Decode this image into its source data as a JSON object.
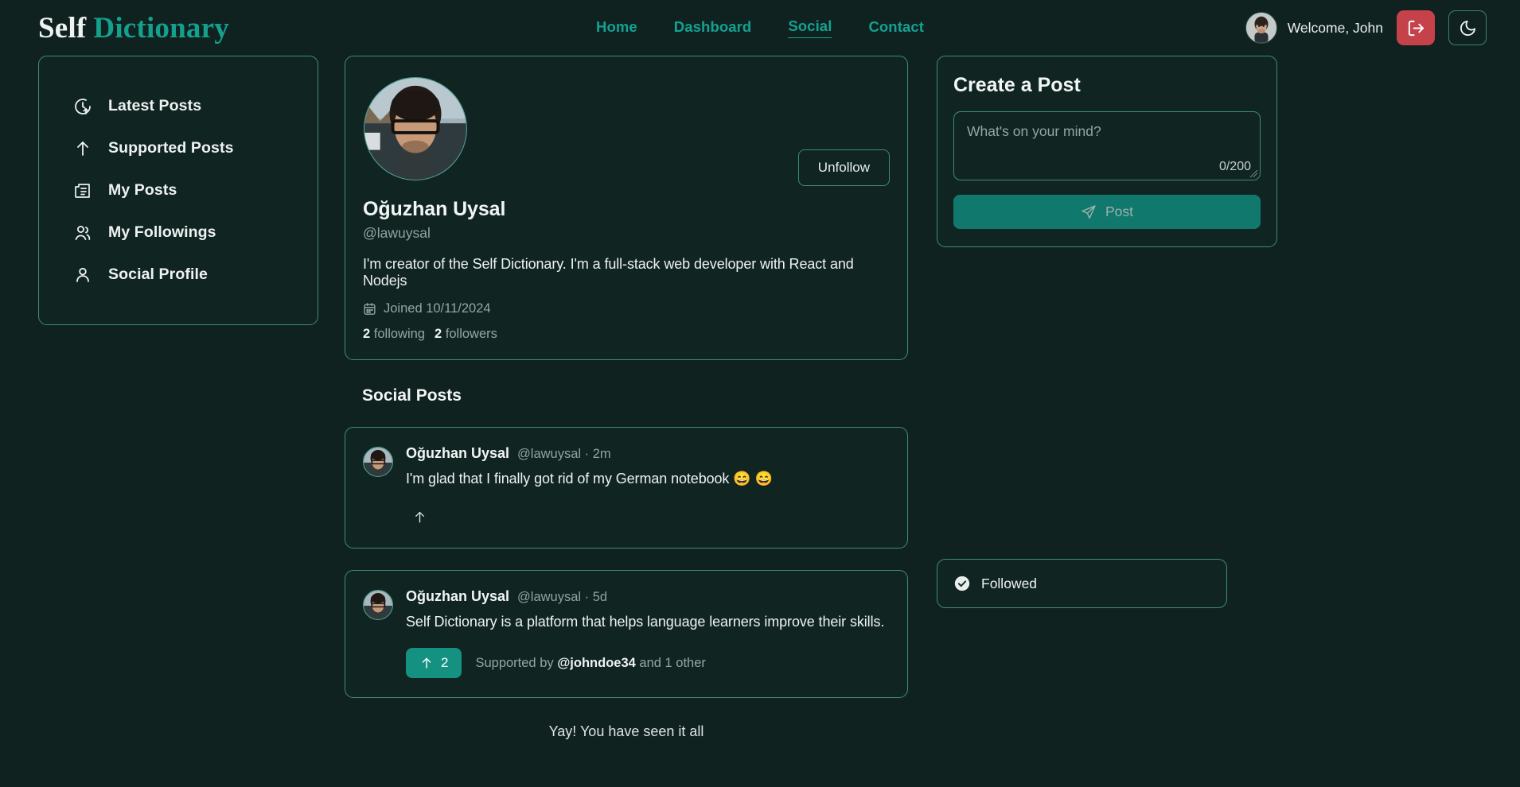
{
  "brand": {
    "word1": "Self",
    "word2": "Dictionary"
  },
  "nav": {
    "items": [
      {
        "label": "Home",
        "active": false
      },
      {
        "label": "Dashboard",
        "active": false
      },
      {
        "label": "Social",
        "active": true
      },
      {
        "label": "Contact",
        "active": false
      }
    ]
  },
  "header": {
    "welcome": "Welcome, John",
    "logout_icon": "logout-icon",
    "theme_icon": "moon-icon",
    "accent": "#13a291",
    "logout_color": "#c6424b"
  },
  "sidebar": {
    "items": [
      {
        "label": "Latest Posts",
        "icon": "clock-arrow-up-icon"
      },
      {
        "label": "Supported Posts",
        "icon": "arrow-up-icon"
      },
      {
        "label": "My Posts",
        "icon": "newspaper-icon"
      },
      {
        "label": "My Followings",
        "icon": "users-icon"
      },
      {
        "label": "Social Profile",
        "icon": "user-icon"
      }
    ]
  },
  "profile": {
    "name": "Oğuzhan Uysal",
    "handle": "@lawuysal",
    "bio": "I'm creator of the Self Dictionary. I'm a full-stack web developer with React and Nodejs",
    "joined_icon": "calendar-icon",
    "joined": "Joined 10/11/2024",
    "following_count": "2",
    "following_label": "following",
    "followers_count": "2",
    "followers_label": "followers",
    "unfollow_label": "Unfollow"
  },
  "feed": {
    "title": "Social Posts",
    "end_message": "Yay! You have seen it all",
    "posts": [
      {
        "name": "Oğuzhan Uysal",
        "meta": "@lawuysal · 2m",
        "text": "I'm glad that I finally got rid of my German notebook 😄 😄",
        "support_count": "",
        "supported": false,
        "supported_by": ""
      },
      {
        "name": "Oğuzhan Uysal",
        "meta": "@lawuysal · 5d",
        "text": "Self Dictionary is a platform that helps language learners improve their skills.",
        "support_count": "2",
        "supported": true,
        "supported_by_prefix": "Supported by ",
        "supported_by_user": "@johndoe34",
        "supported_by_suffix": " and 1 other"
      }
    ]
  },
  "create_post": {
    "title": "Create a Post",
    "placeholder": "What's on your mind?",
    "value": "",
    "counter": "0/200",
    "button_label": "Post",
    "button_icon": "send-icon"
  },
  "toast": {
    "icon": "check-circle-icon",
    "label": "Followed"
  }
}
